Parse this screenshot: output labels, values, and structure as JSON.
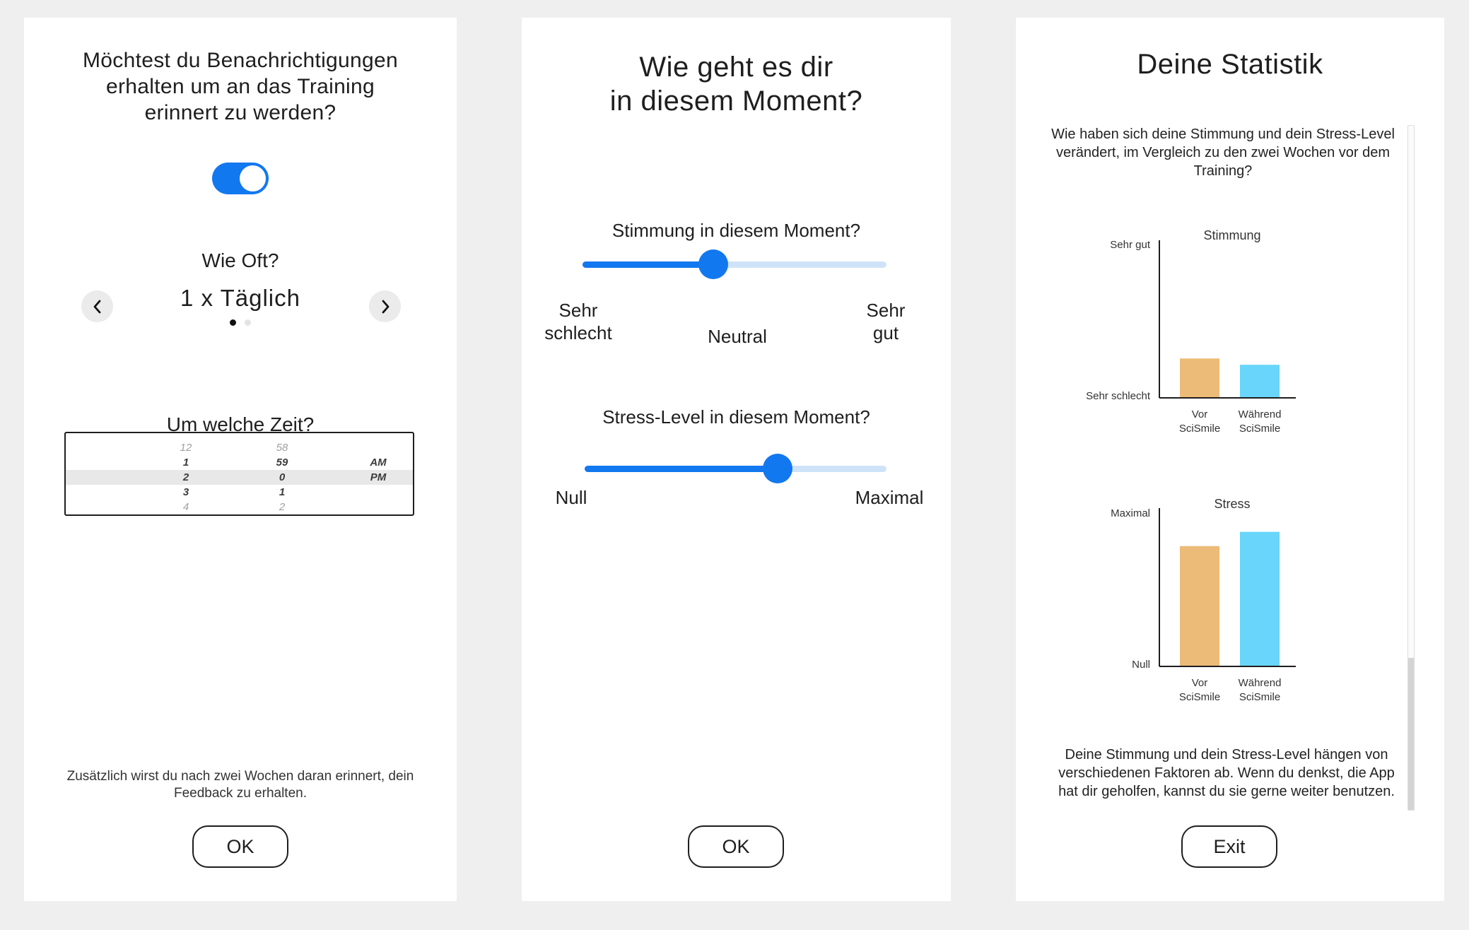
{
  "notifications_screen": {
    "question": "Möchtest du Benachrichtigungen erhalten um an das Training erinnert zu werden?",
    "toggle_on": true,
    "frequency_label": "Wie Oft?",
    "frequency_value": "1 x Täglich",
    "page_indicator": {
      "count": 2,
      "active": 1
    },
    "time_label": "Um welche Zeit?",
    "time_picker": {
      "rows": [
        [
          "12",
          "58",
          ""
        ],
        [
          "1",
          "59",
          "AM"
        ],
        [
          "2",
          "0",
          "PM"
        ],
        [
          "3",
          "1",
          ""
        ],
        [
          "4",
          "2",
          ""
        ]
      ],
      "selected_row": 2
    },
    "footnote": "Zusätzlich wirst du nach zwei Wochen daran erinnert, dein Feedback zu erhalten.",
    "ok_label": "OK"
  },
  "mood_screen": {
    "title_line1": "Wie geht es dir",
    "title_line2": "in diesem Moment?",
    "mood_slider": {
      "label": "Stimmung in diesem Moment?",
      "value": 0.43,
      "min_label_line1": "Sehr",
      "min_label_line2": "schlecht",
      "mid_label": "Neutral",
      "max_label_line1": "Sehr",
      "max_label_line2": "gut"
    },
    "stress_slider": {
      "label": "Stress-Level in diesem Moment?",
      "value": 0.64,
      "min_label": "Null",
      "max_label": "Maximal"
    },
    "ok_label": "OK"
  },
  "stats_screen": {
    "title": "Deine Statistik",
    "intro": "Wie haben sich deine Stimmung und dein Stress-Level verändert, im Vergleich zu den zwei Wochen vor dem Training?",
    "outro": "Deine Stimmung und dein Stress-Level hängen von verschiedenen Faktoren ab. Wenn du denkst, die App hat dir geholfen, kannst du sie gerne weiter benutzen.",
    "exit_label": "Exit",
    "colors": {
      "before": "#ecbb78",
      "during": "#69d5fa"
    }
  },
  "chart_data": [
    {
      "type": "bar",
      "title": "Stimmung",
      "categories": [
        "Vor SciSmile",
        "Während SciSmile"
      ],
      "cat_lines": [
        [
          "Vor",
          "SciSmile"
        ],
        [
          "Während",
          "SciSmile"
        ]
      ],
      "values": [
        0.25,
        0.21
      ],
      "ylim": [
        0,
        1
      ],
      "ytick_top": "Sehr gut",
      "ytick_bottom": "Sehr schlecht"
    },
    {
      "type": "bar",
      "title": "Stress",
      "categories": [
        "Vor SciSmile",
        "Während SciSmile"
      ],
      "cat_lines": [
        [
          "Vor",
          "SciSmile"
        ],
        [
          "Während",
          "SciSmile"
        ]
      ],
      "values": [
        0.76,
        0.85
      ],
      "ylim": [
        0,
        1
      ],
      "ytick_top": "Maximal",
      "ytick_bottom": "Null"
    }
  ]
}
